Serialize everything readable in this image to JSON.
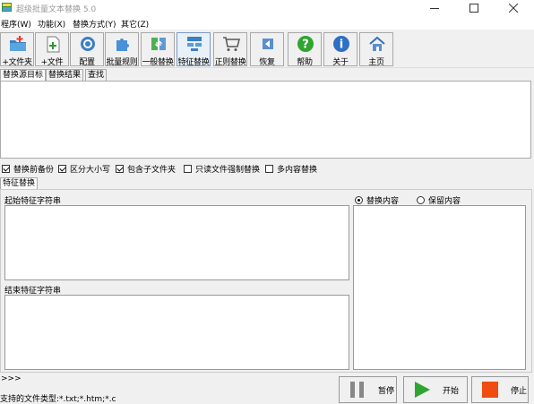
{
  "window": {
    "title": "超级批量文本替换 5.0",
    "controls": [
      "minimize-icon",
      "maximize-icon",
      "close-icon"
    ]
  },
  "menu": {
    "items": [
      {
        "label": "程序(W)"
      },
      {
        "label": "功能(X)"
      },
      {
        "label": "替换方式(Y)"
      },
      {
        "label": "其它(Z)"
      }
    ]
  },
  "toolbar": {
    "buttons": [
      {
        "label": "+文件夹",
        "icon": "add-folder-icon"
      },
      {
        "label": "+文件",
        "icon": "add-file-icon"
      },
      {
        "label": "配置",
        "icon": "config-icon"
      },
      {
        "label": "批量规则",
        "icon": "puzzle-icon"
      },
      {
        "label": "一般替换",
        "icon": "swap-icon"
      },
      {
        "label": "特征替换",
        "icon": "feature-replace-icon",
        "active": true
      },
      {
        "label": "正则替换",
        "icon": "cart-icon"
      },
      {
        "label": "恢复",
        "icon": "restore-icon"
      },
      {
        "label": "帮助",
        "icon": "help-icon"
      },
      {
        "label": "关于",
        "icon": "about-icon"
      },
      {
        "label": "主页",
        "icon": "home-icon"
      }
    ]
  },
  "tabs": {
    "items": [
      {
        "label": "替换源目标",
        "selected": true
      },
      {
        "label": "替换结果"
      },
      {
        "label": "查找"
      }
    ]
  },
  "options": {
    "items": [
      {
        "label": "替换前备份",
        "checked": true
      },
      {
        "label": "区分大小写",
        "checked": true
      },
      {
        "label": "包含子文件夹",
        "checked": true
      },
      {
        "label": "只读文件强制替换",
        "checked": false
      },
      {
        "label": "多内容替换",
        "checked": false
      }
    ]
  },
  "feature_panel": {
    "tab_label": "特征替换",
    "start_label": "起始特征字符串",
    "end_label": "结束特征字符串",
    "radio_replace": "替换内容",
    "radio_keep": "保留内容",
    "selected_radio": "替换内容"
  },
  "footer": {
    "log_text": ">>>",
    "status_text": "支持的文件类型:*.txt;*.htm;*.c",
    "pause_label": "暂停",
    "start_label": "开始",
    "stop_label": "停止"
  },
  "colors": {
    "start_green": "#2fa52f",
    "stop_orange": "#ef4b12",
    "pause_gray": "#888888"
  }
}
